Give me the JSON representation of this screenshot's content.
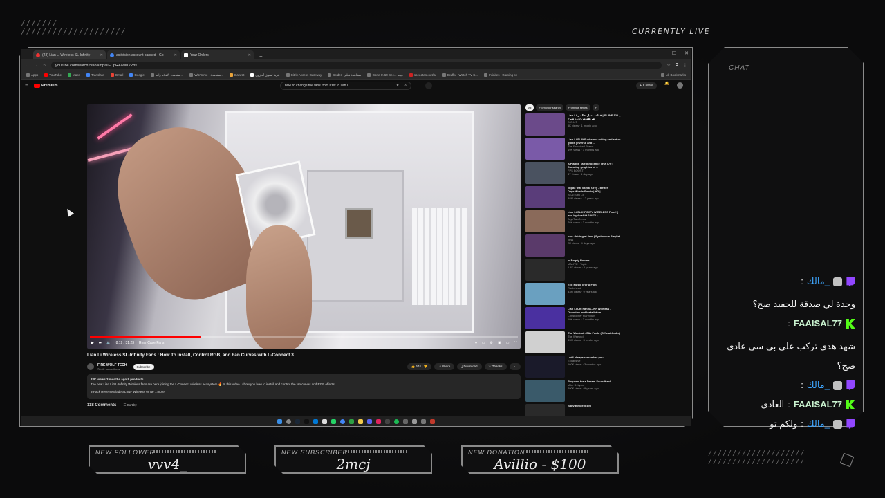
{
  "overlay": {
    "live_label": "CURRENTLY LIVE",
    "slashes_tl_1": "///////",
    "slashes_tl_2": "////////////////////",
    "slashes_br_1": "////////////////////",
    "slashes_br_2": "////////////////////"
  },
  "browser": {
    "tabs": [
      {
        "label": "(23) Lian Li Wireless SL-Infinity"
      },
      {
        "label": "activision account banned - Go"
      },
      {
        "label": "Your Orders"
      }
    ],
    "new_tab": "+",
    "url": "youtube.com/watch?v=oNmpallFCpRA&t=1728s",
    "bookmarks": [
      "Apps",
      "YouTube",
      "Maps",
      "Translate",
      "Gmail",
      "Google",
      "مشاهدة الأفلام والم...",
      "WitAnime - مشاهدة...",
      "Dawrat",
      "عربة تسوق أمازون",
      "Citrix Access Gateway",
      "Spider - مشاهدة فيلم",
      "Gone In 60 Sec... فيلم",
      "speedtest.net/ar",
      "Braflix - Watch TV S...",
      "Infinites | Gaming pc",
      "All Bookmarks"
    ]
  },
  "youtube": {
    "logo": "Premium",
    "search_query": "how to change the fans from nzxt to lian li",
    "create_label": "Create",
    "video_time": "8:19 / 31:23",
    "chapter": "Rear Case Fans",
    "progress_fraction": 0.26,
    "title": "Lian Li Wireless SL-Infinity Fans : How To Install, Control RGB, and Fan Curves with L-Connect 3",
    "channel": "FIRE WOLF TECH",
    "subscribers": "78.6K subscribers",
    "subscribe_label": "Subscribe",
    "likes": "674",
    "share_label": "Share",
    "download_label": "Download",
    "thanks_label": "Thanks",
    "desc_meta": "33K views  3 months ago  8 products",
    "desc_line1": "The new Lian Li SL-Infinity Wireless fans are here joining the L-Connect wireless ecosystem 🔥 In this video I show you how to install and control the fan curves and RGB effects.",
    "desc_line2": "3-Pack Reverse Blade SL-INF Wireless White ...more",
    "comments_count": "118 Comments",
    "sort_label": "Sort by",
    "chips": [
      "All",
      "From your search",
      "From the series",
      "F"
    ],
    "recommendations": [
      {
        "title": "Lian Li قطعة تعدل عالمي | SL INF 120 _ شرح LCD طريقة من",
        "channel": "D.O.L.T",
        "meta": "5K views · 1 month ago",
        "color": "#6b4a8a"
      },
      {
        "title": "Lian Li SL INF wireless wiring and setup guide (inverse and ...",
        "channel": "The Provoked Prawn",
        "meta": "19K views · 3 months ago",
        "color": "#7a5aa8"
      },
      {
        "title": "A Plague Tale Innocence | RX 570 | Stunning graphics at ...",
        "channel": "FPS BOOST",
        "meta": "47 views · 1 day ago",
        "color": "#4a5260"
      },
      {
        "title": "Tupac feat Skylar Grey - Better Days/Words Remix | HD | ...",
        "channel": "BEATS by LE",
        "meta": "38M views · 12 years ago",
        "color": "#5a3d7a"
      },
      {
        "title": "Lian Li SL INFINITY WIRELESS Fans! ( and Hydroshift 2 AIO! )",
        "channel": "JayzTwoCents",
        "meta": "76K views · 3 months ago",
        "color": "#8a6a5a"
      },
      {
        "title": "pov: driving at 3am | Synthwave Playlist",
        "channel": "Jess",
        "meta": "2K views · 4 days ago",
        "color": "#5a3a6a"
      },
      {
        "title": "In Empty Rooms",
        "channel": "MALIVE - Topic",
        "meta": "1.4K views · 5 years ago",
        "color": "#2a2a2a"
      },
      {
        "title": "Exit Music (For A Film)",
        "channel": "Radiohead",
        "meta": "33M views · 9 years ago",
        "color": "#6aa0c0"
      },
      {
        "title": "Lian Li Uni Fan SL-INF Wireless - Overview and Installation ...",
        "channel": "Christopher Flannigan",
        "meta": "10K views · 3 months ago",
        "color": "#4a30a0"
      },
      {
        "title": "The Weeknd - São Paulo (Official Audio)",
        "channel": "The Weeknd",
        "meta": "43M views · 3 weeks ago",
        "color": "#d0d0d0"
      },
      {
        "title": "I will always remember you",
        "channel": "Expansive",
        "meta": "160K views · 3 months ago",
        "color": "#1a1a2a"
      },
      {
        "title": "Requiem for a Dream Soundtrack",
        "channel": "Mike S. Lynn",
        "meta": "490K views · 9 years ago",
        "color": "#3a5a6a"
      },
      {
        "title": "Baby By Me (Edit)",
        "channel": "",
        "meta": "",
        "color": "#2a2a2a"
      }
    ]
  },
  "chat": {
    "title": "CHAT",
    "messages": [
      {
        "user": "_مالك",
        "sep": ":",
        "text": "وحدة لي صدقة للحفيد صح؟",
        "platform": "twitch",
        "user_style": "ar"
      },
      {
        "user": "FAAISAL77",
        "sep": ":",
        "text": "شهد هذي تركب على بي سي عادي صح؟",
        "platform": "kick",
        "user_style": "en"
      },
      {
        "user": "_مالك",
        "sep": ":",
        "text": "",
        "platform": "twitch",
        "user_style": "ar"
      },
      {
        "user": "FAAISAL77",
        "sep": ":",
        "text": "العادي",
        "platform": "kick",
        "user_style": "en"
      },
      {
        "user": "_مالك",
        "sep": ":",
        "text": "ولكم تو",
        "platform": "twitch",
        "user_style": "ar"
      }
    ]
  },
  "alerts": {
    "follower_label": "NEW FOLLOWER",
    "follower_value": "vvv4_",
    "subscriber_label": "NEW SUBSCRIBER",
    "subscriber_value": "2mcj",
    "donation_label": "NEW DONATION",
    "donation_value": "Avillio - $100"
  },
  "colors": {
    "frame": "#8a8a8a",
    "accent_red": "#ff0000",
    "arabic_user": "#3ea6ff",
    "kick_green": "#53fc18",
    "twitch_purple": "#9146ff"
  }
}
